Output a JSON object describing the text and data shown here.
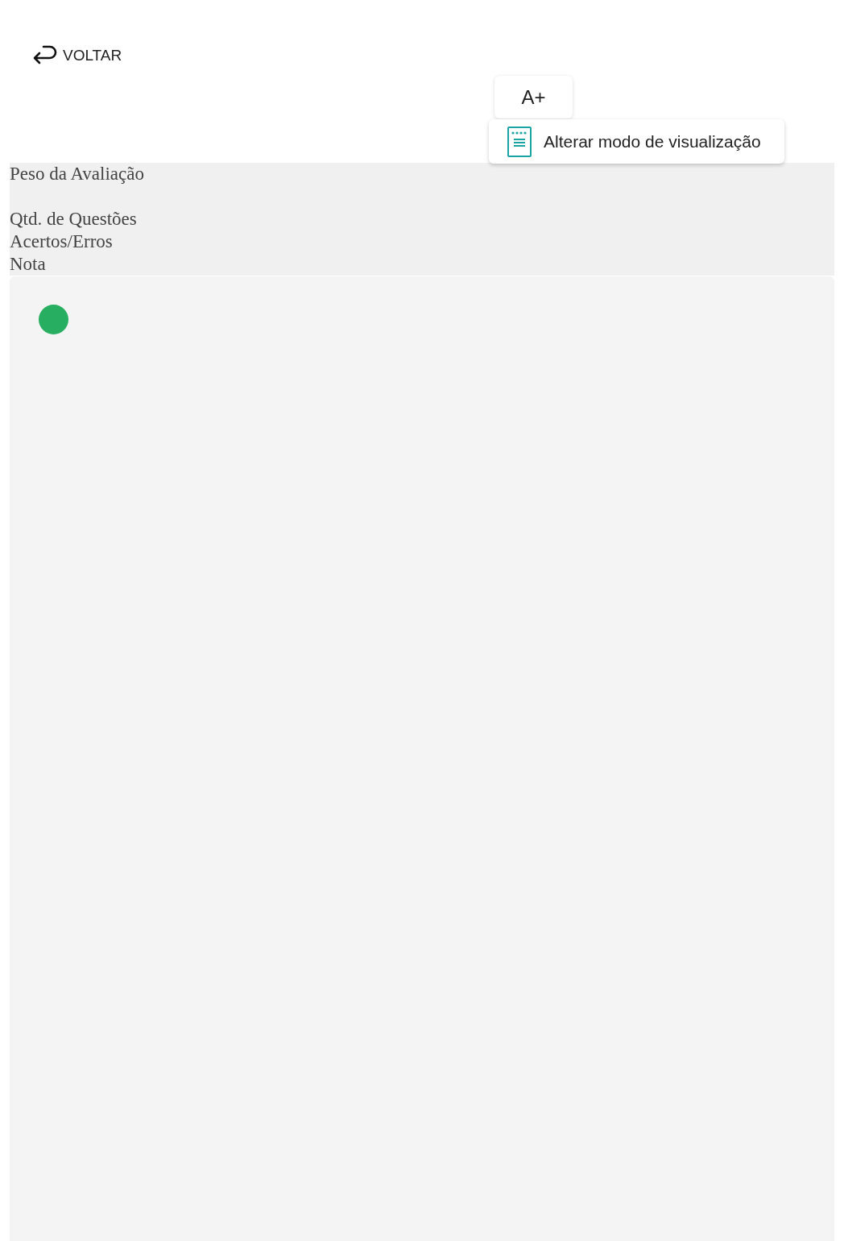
{
  "back_button": {
    "label": "VOLTAR"
  },
  "font_button": {
    "label": "A+"
  },
  "view_menu": {
    "items": [
      {
        "label": "Alterar modo de visualização"
      }
    ]
  },
  "summary": {
    "labels": [
      "Peso da Avaliação",
      "Qtd. de Questões",
      "Acertos/Erros",
      "Nota"
    ]
  }
}
